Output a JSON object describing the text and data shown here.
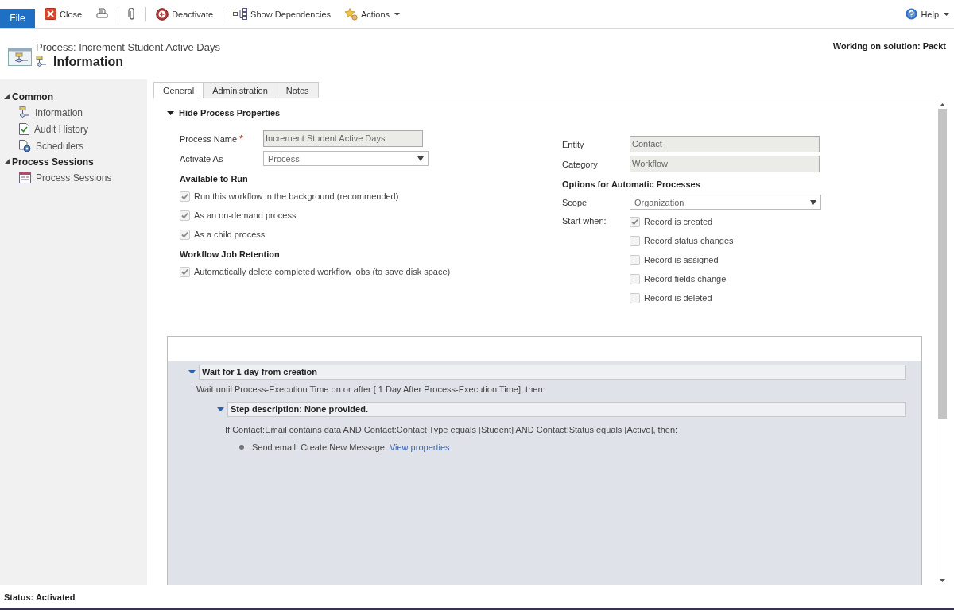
{
  "toolbar": {
    "file": "File",
    "close": "Close",
    "deactivate": "Deactivate",
    "show_dependencies": "Show Dependencies",
    "actions": "Actions",
    "help": "Help"
  },
  "header": {
    "breadcrumb": "Process: Increment Student Active Days",
    "title": "Information",
    "solution": "Working on solution: Packt"
  },
  "sidebar": [
    {
      "label": "Common",
      "expanded": true,
      "items": [
        {
          "label": "Information"
        },
        {
          "label": "Audit History"
        },
        {
          "label": "Schedulers"
        }
      ]
    },
    {
      "label": "Process Sessions",
      "expanded": true,
      "items": [
        {
          "label": "Process Sessions"
        }
      ]
    }
  ],
  "tabs": [
    {
      "label": "General",
      "selected": true
    },
    {
      "label": "Administration",
      "selected": false
    },
    {
      "label": "Notes",
      "selected": false
    }
  ],
  "section": {
    "title": "Hide Process Properties",
    "expanded": true
  },
  "left_form": {
    "process_name": {
      "label": "Process Name",
      "required_mark": "*",
      "value": "Increment Student Active Days"
    },
    "activate_as": {
      "label": "Activate As",
      "value": "Process"
    },
    "available_to_run": {
      "title": "Available to Run",
      "options": [
        {
          "label": "Run this workflow in the background (recommended)",
          "checked": true
        },
        {
          "label": "As an on-demand process",
          "checked": true
        },
        {
          "label": "As a child process",
          "checked": true
        }
      ]
    },
    "retention": {
      "title": "Workflow Job Retention",
      "options": [
        {
          "label": "Automatically delete completed workflow jobs (to save disk space)",
          "checked": true
        }
      ]
    }
  },
  "right_form": {
    "entity": {
      "label": "Entity",
      "value": "Contact"
    },
    "category": {
      "label": "Category",
      "value": "Workflow"
    },
    "options_title": "Options for Automatic Processes",
    "scope": {
      "label": "Scope",
      "value": "Organization"
    },
    "start_when": {
      "label": "Start when:",
      "options": [
        {
          "label": "Record is created",
          "checked": true
        },
        {
          "label": "Record status changes",
          "checked": false
        },
        {
          "label": "Record is assigned",
          "checked": false
        },
        {
          "label": "Record fields change",
          "checked": false
        },
        {
          "label": "Record is deleted",
          "checked": false
        }
      ]
    }
  },
  "designer": [
    {
      "kind": "stage",
      "title": "Wait for 1 day from creation",
      "expanded": true,
      "children": [
        {
          "kind": "text",
          "text": "Wait until Process-Execution Time on or after [ 1 Day After Process-Execution Time], then:"
        },
        {
          "kind": "stage",
          "title": "Step description: None provided.",
          "expanded": true,
          "children": [
            {
              "kind": "text",
              "text": "If Contact:Email contains data AND Contact:Contact Type equals [Student] AND Contact:Status equals [Active], then:"
            },
            {
              "kind": "action",
              "text": "Send email:  Create New Message",
              "link": "View properties"
            }
          ]
        }
      ]
    }
  ],
  "status_bar": "Status: Activated"
}
